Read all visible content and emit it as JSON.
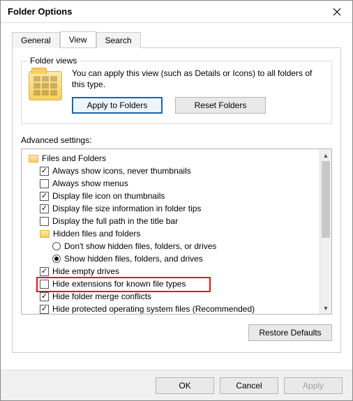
{
  "window": {
    "title": "Folder Options"
  },
  "tabs": {
    "general": "General",
    "view": "View",
    "search": "Search",
    "active": "view"
  },
  "folder_views": {
    "group_label": "Folder views",
    "description": "You can apply this view (such as Details or Icons) to all folders of this type.",
    "apply_btn": "Apply to Folders",
    "reset_btn": "Reset Folders"
  },
  "advanced": {
    "label": "Advanced settings:",
    "root": "Files and Folders",
    "items": [
      {
        "type": "check",
        "checked": true,
        "label": "Always show icons, never thumbnails"
      },
      {
        "type": "check",
        "checked": false,
        "label": "Always show menus"
      },
      {
        "type": "check",
        "checked": true,
        "label": "Display file icon on thumbnails"
      },
      {
        "type": "check",
        "checked": true,
        "label": "Display file size information in folder tips"
      },
      {
        "type": "check",
        "checked": false,
        "label": "Display the full path in the title bar"
      },
      {
        "type": "folder",
        "label": "Hidden files and folders"
      },
      {
        "type": "radio",
        "selected": false,
        "label": "Don't show hidden files, folders, or drives"
      },
      {
        "type": "radio",
        "selected": true,
        "label": "Show hidden files, folders, and drives"
      },
      {
        "type": "check",
        "checked": true,
        "label": "Hide empty drives"
      },
      {
        "type": "check",
        "checked": false,
        "label": "Hide extensions for known file types",
        "highlight": true
      },
      {
        "type": "check",
        "checked": true,
        "label": "Hide folder merge conflicts"
      },
      {
        "type": "check",
        "checked": true,
        "label": "Hide protected operating system files (Recommended)"
      }
    ],
    "restore_btn": "Restore Defaults"
  },
  "footer": {
    "ok": "OK",
    "cancel": "Cancel",
    "apply": "Apply"
  }
}
